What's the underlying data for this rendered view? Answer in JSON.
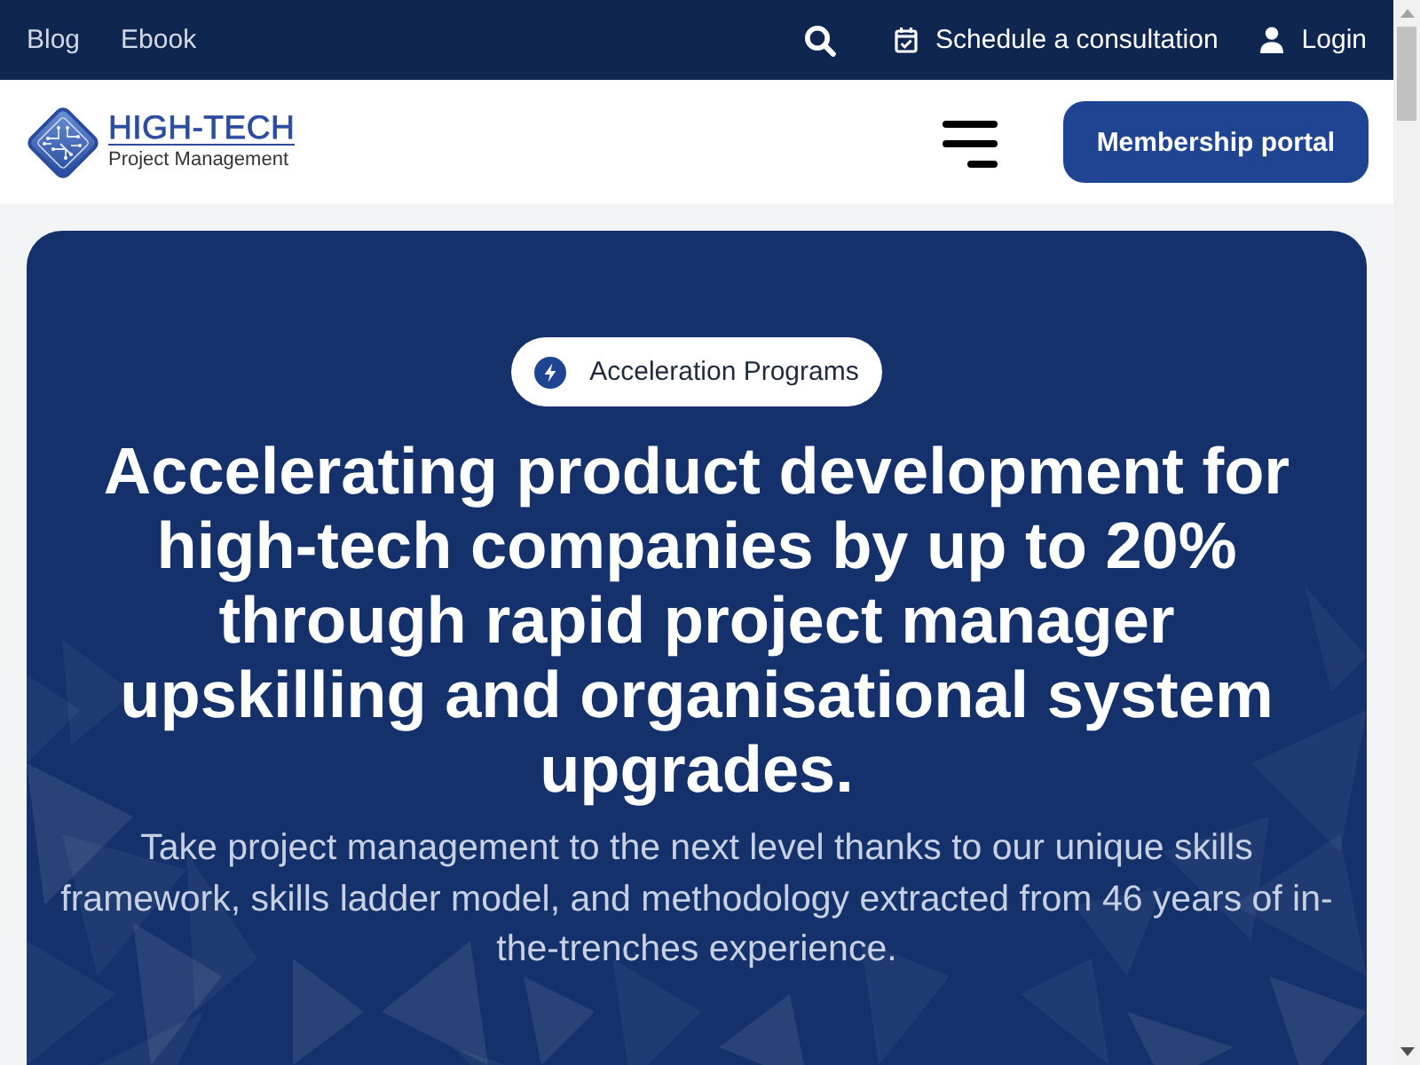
{
  "top_bar": {
    "links": [
      {
        "label": "Blog"
      },
      {
        "label": "Ebook"
      }
    ],
    "actions": [
      {
        "kind": "search"
      },
      {
        "kind": "schedule",
        "label": "Schedule a consultation"
      },
      {
        "kind": "login",
        "label": "Login"
      }
    ]
  },
  "header": {
    "logo": {
      "title": "HIGH-TECH",
      "subtitle": "Project Management"
    },
    "button": {
      "label": "Membership portal"
    }
  },
  "hero": {
    "badge": {
      "label": "Acceleration Programs"
    },
    "headline": "Accelerating product development for high-tech companies by up to 20% through rapid project manager upskilling and organisational system upgrades.",
    "subtitle": "Take project management to the next level thanks to our unique skills framework, skills ladder model, and methodology extracted from 46 years of in-the-trenches experience."
  }
}
